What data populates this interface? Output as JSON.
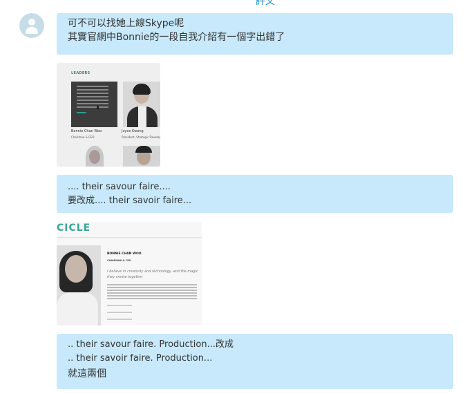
{
  "header": {
    "partial_label": "評文"
  },
  "messages": [
    {
      "type": "text",
      "lines": [
        "可不可以找她上線Skype呢",
        "其實官網中Bonnie的一段自我介紹有一個字出錯了"
      ]
    },
    {
      "type": "image",
      "image": {
        "heading": "LEADERS",
        "people": [
          {
            "name": "Bonnie Chan Woo",
            "title": "Chairman & CEO"
          },
          {
            "name": "Joyce Kwong",
            "title": "President, Strategic Development"
          }
        ]
      }
    },
    {
      "type": "text",
      "lines": [
        ".... their savour faire....",
        "要改成....  their savoir faire..."
      ]
    },
    {
      "type": "image",
      "image": {
        "logo": "CICLE",
        "name": "BONNIE CHAN WOO",
        "role": "CHAIRMAN & CEO",
        "quote": "I believe in creativity and technology, and the magic they create together"
      }
    },
    {
      "type": "text",
      "lines": [
        ".. their savour faire. Production...改成",
        ".. their savoir faire. Production...",
        "就這兩個"
      ]
    }
  ],
  "colors": {
    "bubble": "#c7e9fb",
    "avatar": "#c6dde8",
    "accent": "#1a8fc9"
  },
  "icons": {
    "avatar": "user-avatar-icon"
  }
}
